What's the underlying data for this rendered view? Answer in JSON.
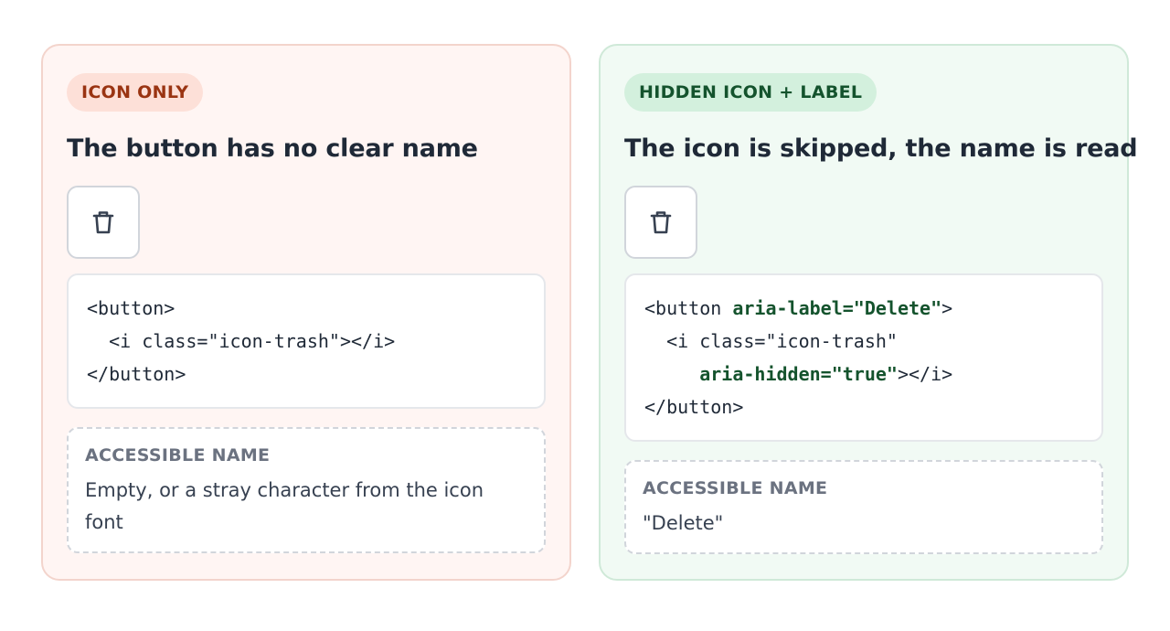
{
  "panels": [
    {
      "variant": "bad",
      "badge": "ICON ONLY",
      "title": "The button has no clear name",
      "icon": "trash-icon",
      "code": {
        "line1": "<button>",
        "line2": "  <i class=\"icon-trash\"></i>",
        "line3": "</button>"
      },
      "accessible_name_label": "ACCESSIBLE NAME",
      "accessible_name_value": "Empty, or a stray character from the icon font"
    },
    {
      "variant": "good",
      "badge": "HIDDEN ICON + LABEL",
      "title": "The icon is skipped, the name is read",
      "icon": "trash-icon",
      "code": {
        "line1_a": "<button ",
        "line1_b": "aria-label=\"Delete\"",
        "line1_c": ">",
        "line2": "  <i class=\"icon-trash\"",
        "line3_indent": "     ",
        "line3_b": "aria-hidden=\"true\"",
        "line3_c": "></i>",
        "line4": "</button>"
      },
      "accessible_name_label": "ACCESSIBLE NAME",
      "accessible_name_value": "\"Delete\""
    }
  ],
  "colors": {
    "bad_bg": "#fff5f3",
    "bad_badge_text": "#9a3412",
    "good_bg": "#f1faf4",
    "good_badge_text": "#14532d",
    "code_highlight": "#14532d"
  }
}
